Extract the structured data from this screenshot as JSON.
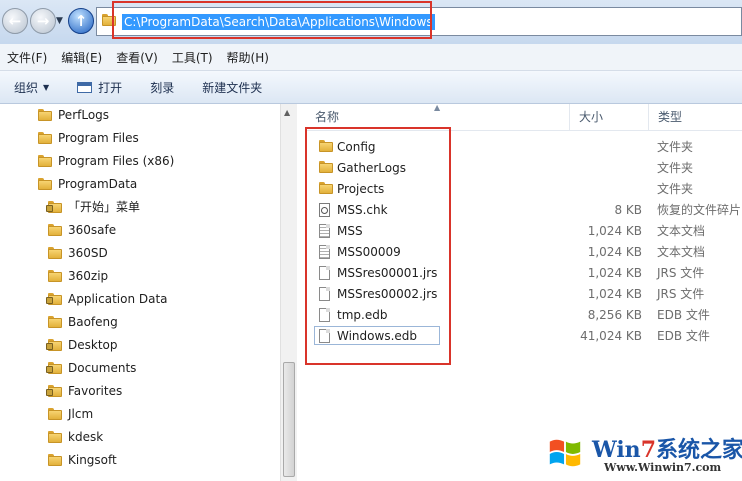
{
  "address_bar": {
    "path": "C:\\ProgramData\\Search\\Data\\Applications\\Windows",
    "highlight_color": "#d9342a"
  },
  "menu": [
    "文件(F)",
    "编辑(E)",
    "查看(V)",
    "工具(T)",
    "帮助(H)"
  ],
  "toolbar": {
    "organize": "组织",
    "open": "打开",
    "burn": "刻录",
    "new_folder": "新建文件夹"
  },
  "nav_tree": [
    {
      "label": "PerfLogs",
      "icon": "folder-icon",
      "level": 0
    },
    {
      "label": "Program Files",
      "icon": "folder-icon",
      "level": 0
    },
    {
      "label": "Program Files (x86)",
      "icon": "folder-icon",
      "level": 0
    },
    {
      "label": "ProgramData",
      "icon": "folder-icon",
      "level": 0
    },
    {
      "label": "「开始」菜单",
      "icon": "locked-folder-icon",
      "level": 1
    },
    {
      "label": "360safe",
      "icon": "folder-icon",
      "level": 1
    },
    {
      "label": "360SD",
      "icon": "folder-icon",
      "level": 1
    },
    {
      "label": "360zip",
      "icon": "folder-icon",
      "level": 1
    },
    {
      "label": "Application Data",
      "icon": "locked-folder-icon",
      "level": 1
    },
    {
      "label": "Baofeng",
      "icon": "folder-icon",
      "level": 1
    },
    {
      "label": "Desktop",
      "icon": "locked-folder-icon",
      "level": 1
    },
    {
      "label": "Documents",
      "icon": "locked-folder-icon",
      "level": 1
    },
    {
      "label": "Favorites",
      "icon": "locked-folder-icon",
      "level": 1
    },
    {
      "label": "Jlcm",
      "icon": "folder-icon",
      "level": 1
    },
    {
      "label": "kdesk",
      "icon": "folder-icon",
      "level": 1
    },
    {
      "label": "Kingsoft",
      "icon": "folder-icon",
      "level": 1
    }
  ],
  "columns": {
    "name": "名称",
    "size": "大小",
    "type": "类型"
  },
  "files": [
    {
      "name": "Config",
      "size": "",
      "type": "文件夹",
      "icon": "folder-icon"
    },
    {
      "name": "GatherLogs",
      "size": "",
      "type": "文件夹",
      "icon": "folder-icon"
    },
    {
      "name": "Projects",
      "size": "",
      "type": "文件夹",
      "icon": "folder-icon"
    },
    {
      "name": "MSS.chk",
      "size": "8 KB",
      "type": "恢复的文件碎片",
      "icon": "chk-file-icon"
    },
    {
      "name": "MSS",
      "size": "1,024 KB",
      "type": "文本文档",
      "icon": "text-file-icon"
    },
    {
      "name": "MSS00009",
      "size": "1,024 KB",
      "type": "文本文档",
      "icon": "text-file-icon"
    },
    {
      "name": "MSSres00001.jrs",
      "size": "1,024 KB",
      "type": "JRS 文件",
      "icon": "file-icon"
    },
    {
      "name": "MSSres00002.jrs",
      "size": "1,024 KB",
      "type": "JRS 文件",
      "icon": "file-icon"
    },
    {
      "name": "tmp.edb",
      "size": "8,256 KB",
      "type": "EDB 文件",
      "icon": "file-icon"
    },
    {
      "name": "Windows.edb",
      "size": "41,024 KB",
      "type": "EDB 文件",
      "icon": "file-icon"
    }
  ],
  "watermark": {
    "title_part1": "Win",
    "title_digit": "7",
    "title_part2": "系统之家",
    "url": "Www.Winwin7.com"
  }
}
